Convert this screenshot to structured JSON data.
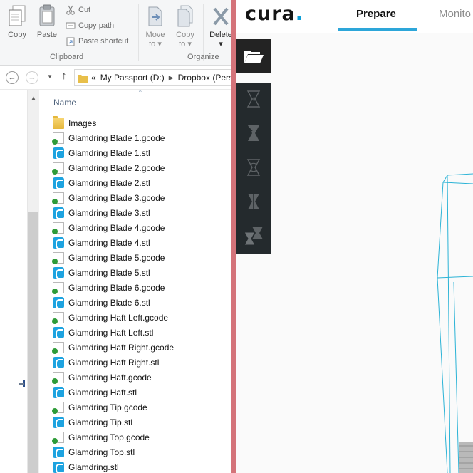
{
  "ribbon": {
    "clipboard": {
      "copy_label": "Copy",
      "paste_label": "Paste",
      "cut_label": "Cut",
      "copy_path_label": "Copy path",
      "paste_shortcut_label": "Paste shortcut",
      "group_label": "Clipboard"
    },
    "organize": {
      "move_to_label": "Move",
      "move_to_sub": "to ▾",
      "copy_to_label": "Copy",
      "copy_to_sub": "to ▾",
      "delete_label": "Delete",
      "delete_sub": "▾",
      "group_label": "Organize"
    }
  },
  "address": {
    "chevron": "«",
    "segments": [
      "My Passport (D:)",
      "Dropbox (Pers"
    ]
  },
  "filelist": {
    "column_name": "Name",
    "files": [
      {
        "name": "Images",
        "type": "folder"
      },
      {
        "name": "Glamdring Blade 1.gcode",
        "type": "gcode"
      },
      {
        "name": "Glamdring Blade 1.stl",
        "type": "stl"
      },
      {
        "name": "Glamdring Blade 2.gcode",
        "type": "gcode"
      },
      {
        "name": "Glamdring Blade 2.stl",
        "type": "stl"
      },
      {
        "name": "Glamdring Blade 3.gcode",
        "type": "gcode"
      },
      {
        "name": "Glamdring Blade 3.stl",
        "type": "stl"
      },
      {
        "name": "Glamdring Blade 4.gcode",
        "type": "gcode"
      },
      {
        "name": "Glamdring Blade 4.stl",
        "type": "stl"
      },
      {
        "name": "Glamdring Blade 5.gcode",
        "type": "gcode"
      },
      {
        "name": "Glamdring Blade 5.stl",
        "type": "stl"
      },
      {
        "name": "Glamdring Blade 6.gcode",
        "type": "gcode"
      },
      {
        "name": "Glamdring Blade 6.stl",
        "type": "stl"
      },
      {
        "name": "Glamdring Haft Left.gcode",
        "type": "gcode"
      },
      {
        "name": "Glamdring Haft Left.stl",
        "type": "stl"
      },
      {
        "name": "Glamdring Haft Right.gcode",
        "type": "gcode"
      },
      {
        "name": "Glamdring Haft Right.stl",
        "type": "stl"
      },
      {
        "name": "Glamdring Haft.gcode",
        "type": "gcode"
      },
      {
        "name": "Glamdring Haft.stl",
        "type": "stl"
      },
      {
        "name": "Glamdring Tip.gcode",
        "type": "gcode"
      },
      {
        "name": "Glamdring Tip.stl",
        "type": "stl"
      },
      {
        "name": "Glamdring Top.gcode",
        "type": "gcode"
      },
      {
        "name": "Glamdring Top.stl",
        "type": "stl"
      },
      {
        "name": "Glamdring.stl",
        "type": "stl"
      }
    ]
  },
  "cura": {
    "logo_text": "cura",
    "logo_dot": ".",
    "tabs": [
      "Prepare",
      "Monito"
    ],
    "accent_color": "#2da6d9",
    "tools": [
      "translate-tool-icon",
      "scale-tool-icon",
      "rotate-tool-icon",
      "mirror-tool-icon",
      "per-model-settings-icon"
    ]
  },
  "colors": {
    "window_divider": "#d4737a",
    "ribbon_bg": "#f5f6f7",
    "toolbar_bg": "#242a2d",
    "model_wireframe": "#2bb3d6"
  }
}
